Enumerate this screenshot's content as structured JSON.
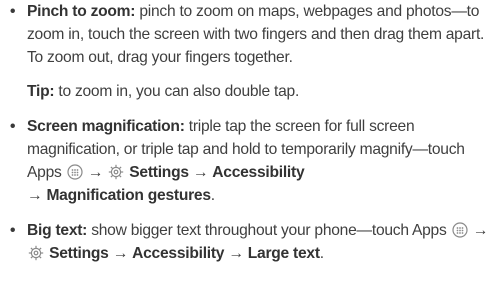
{
  "bullets": {
    "symbol": "•"
  },
  "pinch": {
    "title": "Pinch to zoom:",
    "text": " pinch to zoom on maps, webpages and photos—to zoom in, touch the screen with two fingers and then drag them apart. To zoom out, drag your fingers together."
  },
  "tip": {
    "label": "Tip:",
    "text": " to zoom in, you can also double tap."
  },
  "magnification": {
    "title": "Screen magnification:",
    "text": " triple tap the screen for full screen magnification, or triple tap and hold to temporarily magnify—touch Apps ",
    "arrow1": " → ",
    "settings": "Settings",
    "arrow2": " → ",
    "accessibility": "Accessibility",
    "arrow3": "→ ",
    "gestures": "Magnification gestures",
    "end": "."
  },
  "bigtext": {
    "title": "Big text:",
    "text": " show bigger text throughout your phone—touch Apps ",
    "arrow1": " → ",
    "settings": "Settings",
    "arrow2": " → ",
    "accessibility": "Accessibility",
    "arrow3": " → ",
    "large": "Large text",
    "end": "."
  },
  "icons": {
    "apps": "apps-icon",
    "settings": "settings-gear-icon"
  },
  "colors": {
    "text": "#3f3f3f",
    "bold": "#333333",
    "icon": "#8a8a8a"
  }
}
